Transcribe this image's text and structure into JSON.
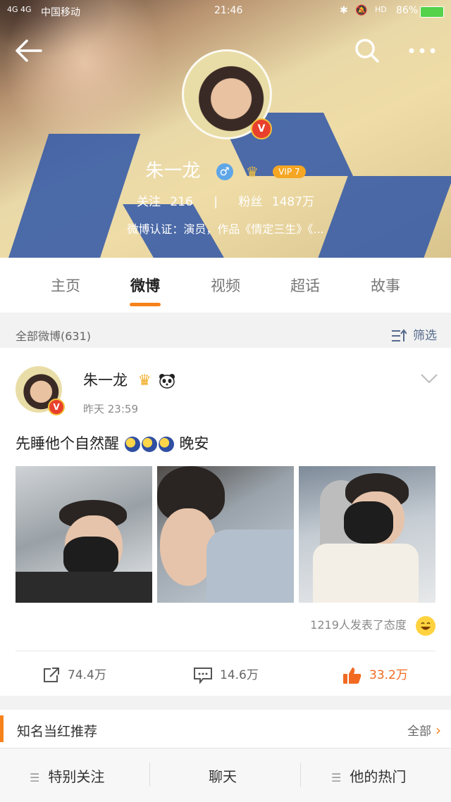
{
  "status_bar": {
    "signal": "4G 4G",
    "carrier": "中国移动",
    "time": "21:46",
    "hd": "HD",
    "battery": "86%"
  },
  "profile": {
    "name": "朱一龙",
    "gender_icon": "male-icon",
    "vip_label": "VIP 7",
    "follow_label": "关注",
    "follow_count": "216",
    "fans_label": "粉丝",
    "fans_count": "1487万",
    "verify_text": "微博认证：演员，作品《情定三生》《..."
  },
  "tabs": [
    {
      "label": "主页",
      "active": false
    },
    {
      "label": "微博",
      "active": true
    },
    {
      "label": "视频",
      "active": false
    },
    {
      "label": "超话",
      "active": false
    },
    {
      "label": "故事",
      "active": false
    }
  ],
  "filter": {
    "all_label": "全部微博(631)",
    "filter_label": "筛选"
  },
  "post": {
    "author": "朱一龙",
    "time": "昨天 23:59",
    "text_before": "先睡他个自然醒",
    "text_after": "晚安",
    "reaction_text": "1219人发表了态度",
    "repost_count": "74.4万",
    "comment_count": "14.6万",
    "like_count": "33.2万"
  },
  "recommend": {
    "title": "知名当红推荐",
    "all_label": "全部"
  },
  "bottom_nav": [
    {
      "label": "特别关注"
    },
    {
      "label": "聊天"
    },
    {
      "label": "他的热门"
    }
  ],
  "colors": {
    "accent": "#f7821b",
    "like": "#f26a22",
    "verify": "#e8402d"
  }
}
